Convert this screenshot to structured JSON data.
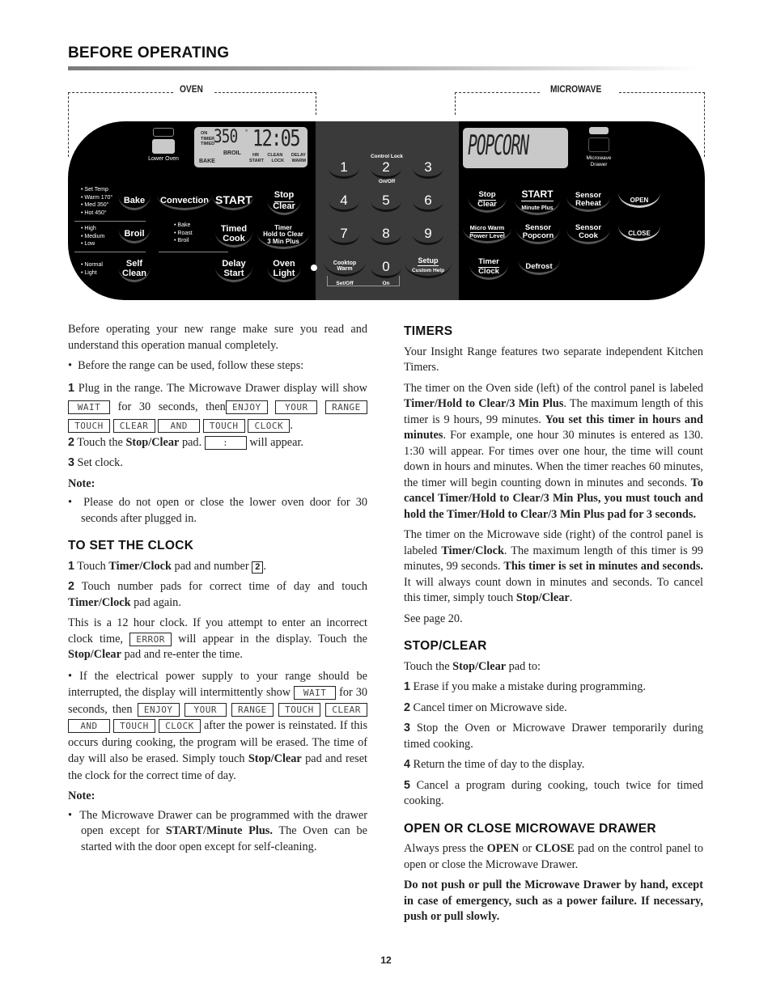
{
  "header": {
    "title": "BEFORE OPERATING",
    "oven_label": "OVEN",
    "microwave_label": "MICROWAVE"
  },
  "panel": {
    "oven": {
      "indicator_label": "Lower Oven",
      "display": {
        "left_tags": [
          "ON",
          "TIMER",
          "TIMED"
        ],
        "temp": "350",
        "degree": "°",
        "time": "12:05",
        "mode_bake": "BAKE",
        "mode_broil": "BROIL",
        "tags_top": [
          "HR",
          "CLEAN",
          "DELAY"
        ],
        "tags_bottom": [
          "START",
          "LOCK",
          "WARM"
        ]
      },
      "bake_options": [
        "• Set Temp",
        "• Warm 170°",
        "• Med 350°",
        "• Hot 450°"
      ],
      "broil_options": [
        "• High",
        "• Medium",
        "• Low"
      ],
      "clean_options": [
        "• Normal",
        "• Light"
      ],
      "convection_options": [
        "• Bake",
        "• Roast",
        "• Broil"
      ],
      "pads": {
        "bake": "Bake",
        "convection": "Convection",
        "start": "START",
        "stop": "Stop",
        "clear": "Clear",
        "broil": "Broil",
        "timed": "Timed",
        "cook": "Cook",
        "timer": "Timer",
        "hold": "Hold to Clear",
        "min_plus": "3 Min Plus",
        "self": "Self",
        "clean": "Clean",
        "delay": "Delay",
        "delay_start": "Start",
        "oven": "Oven",
        "light": "Light"
      }
    },
    "keypad": {
      "control_lock": "Control Lock",
      "on_off": "On/Off",
      "digits": [
        "1",
        "2",
        "3",
        "4",
        "5",
        "6",
        "7",
        "8",
        "9",
        "0"
      ],
      "cooktop": "Cooktop",
      "warm": "Warm",
      "set_off": "Set/Off",
      "on": "On",
      "setup": "Setup",
      "custom_help": "Custom Help"
    },
    "microwave": {
      "display": "POPCORN",
      "indicator_label": "Microwave Drawer",
      "pads": {
        "stop": "Stop",
        "clear": "Clear",
        "start": "START",
        "minute_plus": "Minute Plus",
        "sensor": "Sensor",
        "reheat": "Reheat",
        "open": "OPEN",
        "micro_warm": "Micro Warm",
        "power_level": "Power Level",
        "popcorn": "Popcorn",
        "cook": "Cook",
        "close": "CLOSE",
        "timer": "Timer",
        "clock": "Clock",
        "defrost": "Defrost"
      }
    }
  },
  "left": {
    "intro": "Before operating your new range make sure you read and understand this operation manual completely.",
    "bullet1": "Before the range can be used, follow these steps:",
    "step1_pre": "Plug in the range. The Microwave Drawer display will show",
    "step1_mid": "for 30 seconds, then",
    "lcd_wait": "WAIT",
    "lcd_words": [
      "ENJOY",
      "YOUR",
      "RANGE",
      "TOUCH",
      "CLEAR",
      "AND",
      "TOUCH",
      "CLOCK"
    ],
    "step2_pre": "Touch the",
    "step2_bold": "Stop/Clear",
    "step2_mid": "pad.",
    "step2_lcd": ":",
    "step2_post": "will appear.",
    "step3": "Set clock.",
    "note_label": "Note:",
    "note1": "Please do not open or close the lower oven door for 30 seconds after plugged in.",
    "clock_heading": "TO SET THE CLOCK",
    "clock1_pre": "Touch",
    "clock1_bold": "Timer/Clock",
    "clock1_mid": "pad and number",
    "clock1_key": "2",
    "clock2_pre": "Touch number pads for correct time of day and touch",
    "clock2_bold": "Timer/Clock",
    "clock2_post": "pad again.",
    "clock_para_pre": "This is a 12 hour clock. If you attempt to enter an incorrect clock time,",
    "lcd_error": "ERROR",
    "clock_para_mid": "will appear in the display. Touch the",
    "clock_para_bold": "Stop/Clear",
    "clock_para_post": "pad and re-enter the time.",
    "power_pre": "If the electrical power supply to your range should be interrupted, the display will intermittently show",
    "power_mid": "for 30 seconds, then",
    "power_post1": "after the power is reinstated. If this occurs during cooking, the program will be erased. The time of day will also be erased. Simply touch",
    "power_bold": "Stop/Clear",
    "power_post2": "pad and reset the clock for the correct time of day.",
    "note2_pre": "The Microwave Drawer can be programmed with the drawer open except for",
    "note2_bold": "START/Minute Plus.",
    "note2_post": "The Oven can be started with the door open except for self-cleaning."
  },
  "right": {
    "timers_heading": "TIMERS",
    "timers_intro": "Your Insight Range features two separate independent Kitchen Timers.",
    "oven_timer_1": "The timer on the Oven side (left) of the control panel is labeled",
    "oven_timer_b1": "Timer/Hold to Clear/3 Min Plus",
    "oven_timer_2": ". The maximum length of this timer is 9 hours, 99 minutes.",
    "oven_timer_b2": "You set this timer in hours and minutes",
    "oven_timer_3": ". For example, one hour 30 minutes is entered as 130. 1:30 will appear. For times over one hour, the time will count down in hours and minutes. When the timer reaches 60 minutes, the timer will begin counting down in minutes and seconds.",
    "oven_timer_b3": "To cancel Timer/Hold to Clear/3 Min Plus, you must touch and hold the Timer/Hold to Clear/3 Min Plus pad for 3 seconds.",
    "mw_timer_1": "The timer on the Microwave side (right) of the control panel is labeled",
    "mw_timer_b1": "Timer/Clock",
    "mw_timer_2": ". The maximum length of this timer is 99 minutes, 99 seconds.",
    "mw_timer_b2": "This timer is set in minutes and seconds.",
    "mw_timer_3": "It will always count down in minutes and seconds. To cancel this timer, simply touch",
    "mw_timer_b3": "Stop/Clear",
    "see_page": "See page 20.",
    "stop_heading": "STOP/CLEAR",
    "stop_intro_pre": "Touch the",
    "stop_intro_bold": "Stop/Clear",
    "stop_intro_post": "pad to:",
    "stop_items": [
      {
        "n": "1",
        "t": "Erase if you make a mistake during programming."
      },
      {
        "n": "2",
        "t": "Cancel timer on Microwave side."
      },
      {
        "n": "3",
        "t": "Stop the Oven or Microwave Drawer temporarily during timed cooking."
      },
      {
        "n": "4",
        "t": "Return the time of day to the display."
      },
      {
        "n": "5",
        "t": "Cancel a program during cooking, touch twice for timed cooking."
      }
    ],
    "drawer_heading": "OPEN OR CLOSE MICROWAVE DRAWER",
    "drawer_1": "Always press the",
    "drawer_b1": "OPEN",
    "drawer_2": "or",
    "drawer_b2": "CLOSE",
    "drawer_3": "pad on the control panel to open or close the Microwave Drawer.",
    "drawer_warning": "Do not push or pull the Microwave Drawer by hand, except in case of emergency, such as a power failure. If necessary, push or pull slowly."
  },
  "footer": {
    "page_number": "12"
  }
}
